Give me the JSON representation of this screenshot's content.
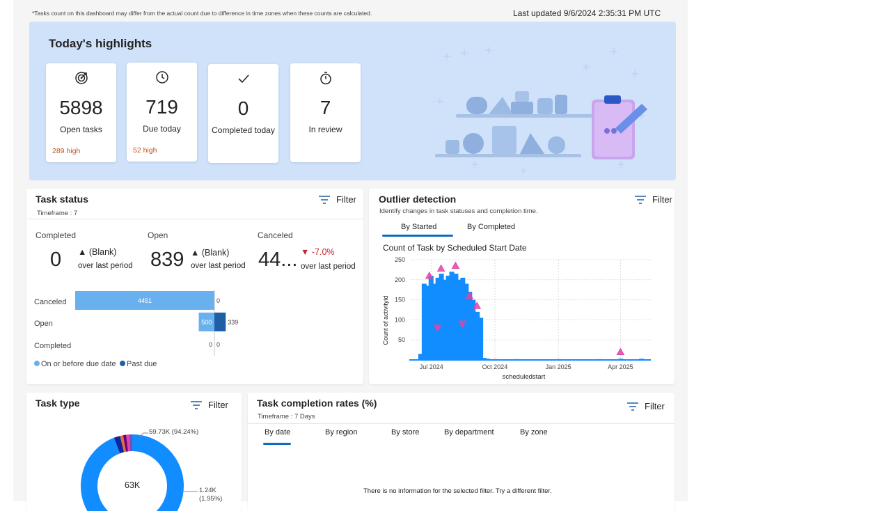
{
  "header": {
    "note": "*Tasks count on this dashboard may differ from the actual count due to difference in time zones when these counts are calculated.",
    "last_updated": "Last updated 9/6/2024 2:35:31 PM UTC"
  },
  "highlights": {
    "title": "Today's highlights",
    "cards": [
      {
        "icon": "target-icon",
        "value": "5898",
        "label": "Open tasks",
        "sub": "289 high"
      },
      {
        "icon": "clock-icon",
        "value": "719",
        "label": "Due today",
        "sub": "52 high"
      },
      {
        "icon": "checkmark-icon",
        "value": "0",
        "label": "Completed today",
        "sub": ""
      },
      {
        "icon": "stopwatch-icon",
        "value": "7",
        "label": "In review",
        "sub": ""
      }
    ]
  },
  "task_status": {
    "title": "Task status",
    "timeframe": "Timeframe : 7",
    "filter_label": "Filter",
    "kpis": [
      {
        "label": "Completed",
        "value": "0",
        "delta": "(Blank)",
        "over": "over last period"
      },
      {
        "label": "Open",
        "value": "839",
        "delta": "(Blank)",
        "over": "over last period"
      },
      {
        "label": "Canceled",
        "value": "44...",
        "delta": "-7.0%",
        "over": "over last period"
      }
    ],
    "bar_chart": {
      "categories": [
        "Canceled",
        "Open",
        "Completed"
      ],
      "on_or_before": [
        4451,
        500,
        0
      ],
      "past_due": [
        0,
        339,
        0
      ],
      "on_or_before_labels": [
        "4451",
        "500",
        "0"
      ],
      "past_due_labels": [
        "0",
        "339",
        "0"
      ],
      "legend": [
        "On or before due date",
        "Past due"
      ],
      "colors": {
        "on_or_before": "#69b1ee",
        "past_due": "#1f5fa6"
      }
    }
  },
  "outlier": {
    "title": "Outlier detection",
    "subtitle": "Identify changes in task statuses and completion time.",
    "filter_label": "Filter",
    "tabs": [
      "By Started",
      "By Completed"
    ],
    "active_tab": "By Started",
    "chart_title": "Count of Task by Scheduled Start Date",
    "y_label": "Count of activityid",
    "x_label": "scheduledstart",
    "y_ticks": [
      "50",
      "100",
      "150",
      "200",
      "250"
    ],
    "x_ticks": [
      "Jul 2024",
      "Oct 2024",
      "Jan 2025",
      "Apr 2025"
    ],
    "colors": {
      "bars": "#118dff",
      "markers": "#e044a7"
    }
  },
  "chart_data": {
    "type": "bar",
    "title": "Count of Task by Scheduled Start Date",
    "xlabel": "scheduledstart",
    "ylabel": "Count of activityid",
    "ylim": [
      0,
      250
    ],
    "x_ticks": [
      "Jul 2024",
      "Oct 2024",
      "Jan 2025",
      "Apr 2025"
    ],
    "x": [
      "2024-06-15",
      "2024-06-20",
      "2024-06-25",
      "2024-06-30",
      "2024-07-05",
      "2024-07-10",
      "2024-07-15",
      "2024-07-20",
      "2024-07-25",
      "2024-07-30",
      "2024-08-05",
      "2024-08-10",
      "2024-08-15",
      "2024-08-20",
      "2024-08-25",
      "2024-08-30",
      "2024-09-05",
      "2024-09-10",
      "2024-09-15",
      "2024-09-20",
      "2024-10-01",
      "2024-11-01",
      "2024-12-01",
      "2025-01-01",
      "2025-02-01",
      "2025-03-01",
      "2025-04-01",
      "2025-05-01"
    ],
    "values": [
      15,
      190,
      185,
      210,
      190,
      205,
      215,
      200,
      210,
      220,
      215,
      200,
      205,
      190,
      170,
      150,
      120,
      105,
      5,
      3,
      2,
      2,
      1,
      2,
      1,
      2,
      3,
      3
    ],
    "anomaly_markers": [
      {
        "date": "2024-06-28",
        "value": 210,
        "direction": "up"
      },
      {
        "date": "2024-07-15",
        "value": 228,
        "direction": "up"
      },
      {
        "date": "2024-08-05",
        "value": 235,
        "direction": "up"
      },
      {
        "date": "2024-08-25",
        "value": 160,
        "direction": "up"
      },
      {
        "date": "2024-09-05",
        "value": 135,
        "direction": "up"
      },
      {
        "date": "2024-07-10",
        "value": 80,
        "direction": "down"
      },
      {
        "date": "2024-08-15",
        "value": 90,
        "direction": "down"
      },
      {
        "date": "2025-04-01",
        "value": 20,
        "direction": "up"
      }
    ]
  },
  "task_type": {
    "title": "Task type",
    "filter_label": "Filter",
    "center_label": "63K",
    "label_big": "59.73K (94.24%)",
    "label_small_1": "1.24K",
    "label_small_2": "(1.95%)",
    "donut": {
      "main_fraction": 0.9424,
      "second_fraction": 0.0195,
      "colors": [
        "#118dff",
        "#12239e",
        "#e66c37",
        "#6b007b",
        "#e044a7",
        "#744ec2"
      ]
    }
  },
  "completion": {
    "title": "Task completion rates (%)",
    "timeframe": "Timeframe : 7 Days",
    "filter_label": "Filter",
    "tabs": [
      "By date",
      "By region",
      "By store",
      "By department",
      "By zone"
    ],
    "active_tab": "By date",
    "empty": "There is no information for the selected filter. Try a different filter."
  }
}
